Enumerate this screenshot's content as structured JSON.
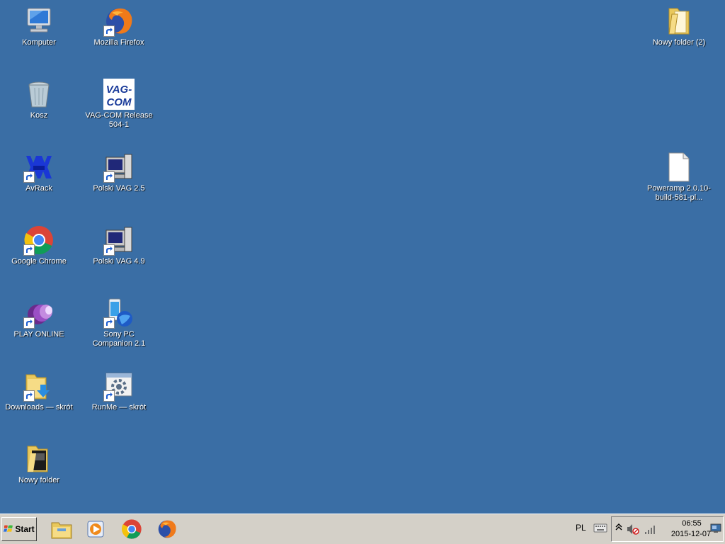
{
  "desktop": {
    "background": "#3a6ea5",
    "icons": [
      {
        "label": "Komputer",
        "icon": "computer-icon",
        "shortcut": false
      },
      {
        "label": "Kosz",
        "icon": "recycle-bin-icon",
        "shortcut": false
      },
      {
        "label": "AvRack",
        "icon": "avrack-icon",
        "shortcut": true
      },
      {
        "label": "Google Chrome",
        "icon": "chrome-icon",
        "shortcut": true
      },
      {
        "label": "PLAY ONLINE",
        "icon": "play-online-icon",
        "shortcut": true
      },
      {
        "label": "Downloads — skrót",
        "icon": "downloads-folder-icon",
        "shortcut": true
      },
      {
        "label": "Nowy folder",
        "icon": "folder-icon",
        "shortcut": false
      },
      {
        "label": "Mozilla Firefox",
        "icon": "firefox-icon",
        "shortcut": true
      },
      {
        "label": "VAG-COM Release 504-1",
        "icon": "vag-com-icon",
        "shortcut": false,
        "icon_text": "VAG-COM"
      },
      {
        "label": "Polski VAG 2.5",
        "icon": "computer-app-icon",
        "shortcut": true
      },
      {
        "label": "Polski VAG 4.9",
        "icon": "computer-app-icon",
        "shortcut": true
      },
      {
        "label": "Sony PC Companion 2.1",
        "icon": "sony-pc-companion-icon",
        "shortcut": true
      },
      {
        "label": "RunMe — skrót",
        "icon": "runme-icon",
        "shortcut": true
      },
      {
        "label": "Nowy folder (2)",
        "icon": "folder-icon",
        "shortcut": false
      },
      {
        "label": "Poweramp 2.0.10-build-581-pl...",
        "icon": "file-icon",
        "shortcut": false
      }
    ]
  },
  "taskbar": {
    "start_label": "Start",
    "pinned": [
      {
        "name": "explorer",
        "icon": "file-explorer-icon"
      },
      {
        "name": "media-player",
        "icon": "media-player-icon"
      },
      {
        "name": "chrome",
        "icon": "chrome-icon"
      },
      {
        "name": "firefox",
        "icon": "firefox-icon"
      }
    ],
    "language": "PL",
    "clock": {
      "time": "06:55",
      "date": "2015-12-07"
    }
  }
}
